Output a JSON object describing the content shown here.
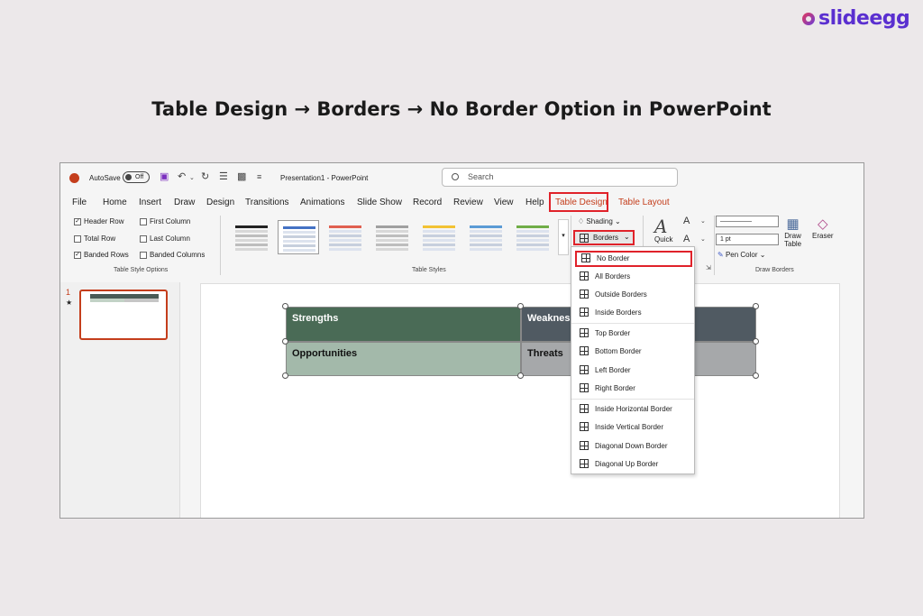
{
  "brand": {
    "name": "slideegg"
  },
  "headline": "Table Design → Borders → No Border Option in PowerPoint",
  "titlebar": {
    "autosave_label": "AutoSave",
    "autosave_state": "Off",
    "document_title": "Presentation1 - PowerPoint",
    "search_placeholder": "Search"
  },
  "menu": {
    "items": [
      "File",
      "Home",
      "Insert",
      "Draw",
      "Design",
      "Transitions",
      "Animations",
      "Slide Show",
      "Record",
      "Review",
      "View",
      "Help",
      "Table Design",
      "Table Layout"
    ],
    "active": "Table Design"
  },
  "table_style_options": {
    "label": "Table Style Options",
    "options": [
      {
        "label": "Header Row",
        "checked": true
      },
      {
        "label": "First Column",
        "checked": false
      },
      {
        "label": "Total Row",
        "checked": false
      },
      {
        "label": "Last Column",
        "checked": false
      },
      {
        "label": "Banded Rows",
        "checked": true
      },
      {
        "label": "Banded Columns",
        "checked": false
      }
    ]
  },
  "table_styles": {
    "label": "Table Styles",
    "accents": [
      "#222222",
      "#4472c4",
      "#e06050",
      "#a0a0a0",
      "#f2c233",
      "#5b9bd5",
      "#70ad47"
    ]
  },
  "shading_label": "Shading",
  "borders_label": "Borders",
  "quick_label": "Quick",
  "draw_borders": {
    "label": "Draw Borders",
    "pen_weight": "1 pt",
    "pen_color_label": "Pen Color",
    "draw_table_line1": "Draw",
    "draw_table_line2": "Table",
    "eraser_label": "Eraser"
  },
  "slides": {
    "current_number": "1"
  },
  "slide_table": {
    "cells": [
      "Strengths",
      "Weakness",
      "Opportunities",
      "Threats"
    ],
    "colors": {
      "strengths": "#4a6b56",
      "weakness": "#505a62",
      "opportunities": "#a3b9aa",
      "threats": "#a6a8aa"
    }
  },
  "borders_menu": {
    "items": [
      {
        "label": "No Border",
        "icon": "no-border-icon",
        "highlighted": true
      },
      {
        "label": "All Borders",
        "icon": "all-borders-icon"
      },
      {
        "label": "Outside Borders",
        "icon": "outside-borders-icon"
      },
      {
        "label": "Inside Borders",
        "icon": "inside-borders-icon"
      },
      {
        "label": "Top Border",
        "icon": "top-border-icon"
      },
      {
        "label": "Bottom Border",
        "icon": "bottom-border-icon"
      },
      {
        "label": "Left Border",
        "icon": "left-border-icon"
      },
      {
        "label": "Right Border",
        "icon": "right-border-icon"
      },
      {
        "label": "Inside Horizontal Border",
        "icon": "inside-horizontal-border-icon"
      },
      {
        "label": "Inside Vertical Border",
        "icon": "inside-vertical-border-icon"
      },
      {
        "label": "Diagonal Down Border",
        "icon": "diagonal-down-border-icon"
      },
      {
        "label": "Diagonal Up Border",
        "icon": "diagonal-up-border-icon"
      }
    ]
  }
}
